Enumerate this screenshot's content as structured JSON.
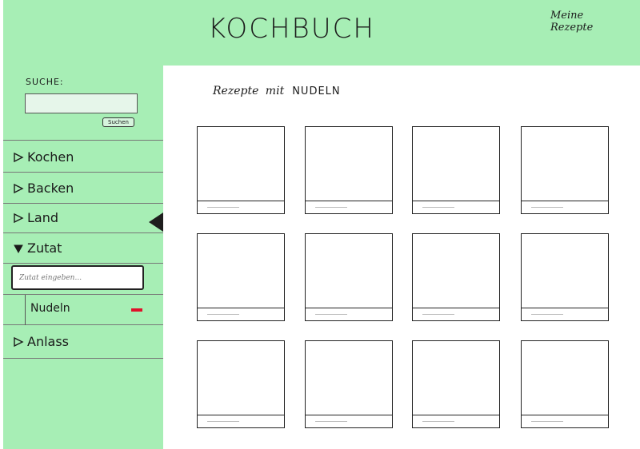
{
  "header": {
    "title": "KOCHBUCH",
    "my_recipes": "Meine Rezepte"
  },
  "sidebar": {
    "search": {
      "label": "SUCHE:",
      "value": "",
      "placeholder": "",
      "button_label": "Suchen"
    },
    "items": [
      {
        "label": "Kochen",
        "expanded": false
      },
      {
        "label": "Backen",
        "expanded": false
      },
      {
        "label": "Land",
        "expanded": false
      },
      {
        "label": "Zutat",
        "expanded": true
      },
      {
        "label": "Anlass",
        "expanded": false
      }
    ],
    "zutat": {
      "placeholder": "Zutat eingeben...",
      "selected": [
        {
          "label": "Nudeln"
        }
      ]
    }
  },
  "main": {
    "heading_prefix": "Rezepte mit",
    "heading_keyword": "NUDELN"
  },
  "colors": {
    "panel_green": "#a7eeb5",
    "remove_red": "#e0102a"
  }
}
